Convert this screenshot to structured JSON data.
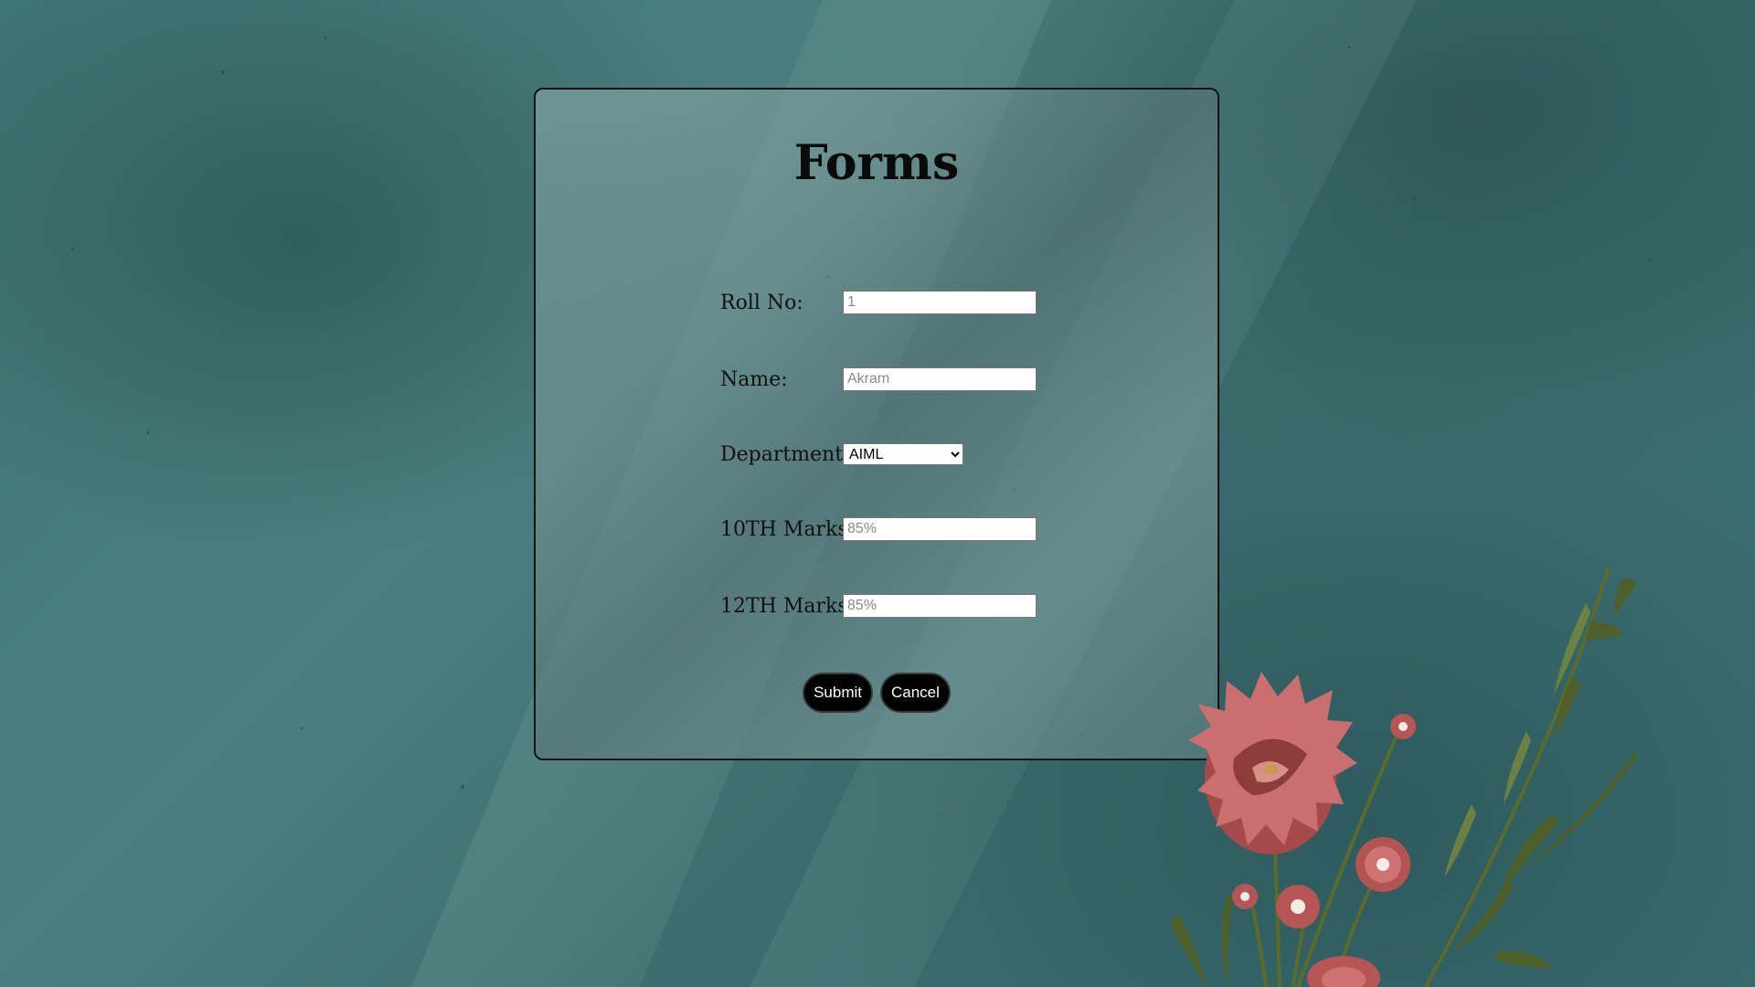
{
  "form": {
    "title": "Forms",
    "fields": {
      "roll_no": {
        "label": "Roll No:",
        "placeholder": "1"
      },
      "name": {
        "label": "Name:",
        "placeholder": "Akram"
      },
      "department": {
        "label": "Department:",
        "selected": "AIML"
      },
      "tenth_marks": {
        "label": "10TH Marks:",
        "placeholder": "85%"
      },
      "twelfth_marks": {
        "label": "12TH Marks:",
        "placeholder": "85%"
      }
    },
    "buttons": {
      "submit_label": "Submit",
      "cancel_label": "Cancel"
    }
  },
  "background": {
    "decoration": "flower-bouquet-icon"
  },
  "colors": {
    "background_teal": "#427777",
    "panel_border": "#141414",
    "button_bg": "#020202",
    "button_text": "#ffffff",
    "flower_red": "#b05a5a"
  }
}
